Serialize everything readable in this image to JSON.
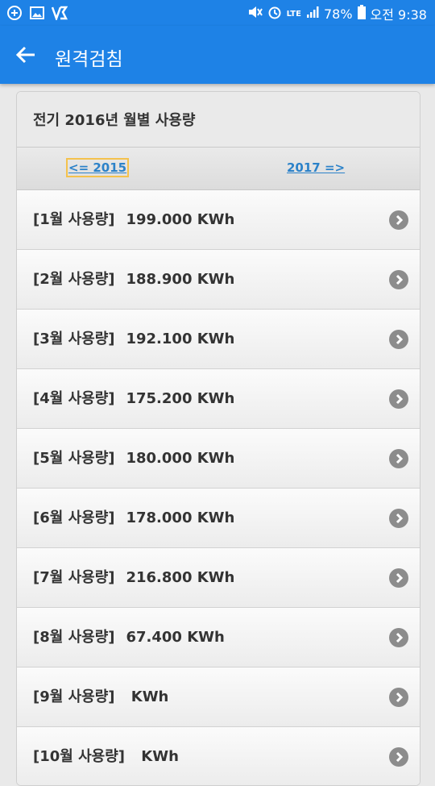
{
  "status_bar": {
    "battery": "78%",
    "time": "오전 9:38",
    "network": "LTE"
  },
  "app_bar": {
    "title": "원격검침"
  },
  "card": {
    "header": "전기 2016년 월별 사용량",
    "prev_link": "<= 2015",
    "next_link": "2017 =>"
  },
  "rows": [
    {
      "label": "[1월 사용량]",
      "value": "199.000 KWh"
    },
    {
      "label": "[2월 사용량]",
      "value": "188.900 KWh"
    },
    {
      "label": "[3월 사용량]",
      "value": "192.100 KWh"
    },
    {
      "label": "[4월 사용량]",
      "value": "175.200 KWh"
    },
    {
      "label": "[5월 사용량]",
      "value": "180.000 KWh"
    },
    {
      "label": "[6월 사용량]",
      "value": "178.000 KWh"
    },
    {
      "label": "[7월 사용량]",
      "value": "216.800 KWh"
    },
    {
      "label": "[8월 사용량]",
      "value": "67.400 KWh"
    },
    {
      "label": "[9월 사용량]",
      "value": " KWh"
    },
    {
      "label": "[10월 사용량]",
      "value": " KWh"
    }
  ],
  "colors": {
    "primary": "#1e82e6",
    "link": "#2c82c9",
    "focus": "#f4c24d"
  }
}
